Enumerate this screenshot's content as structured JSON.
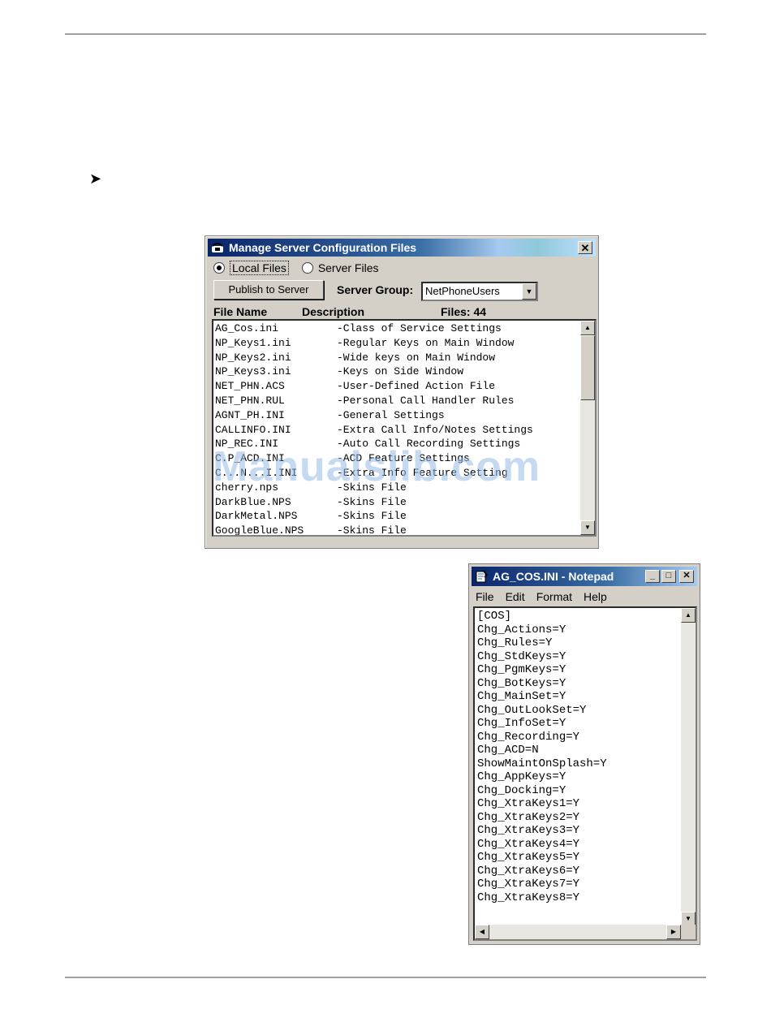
{
  "dialog": {
    "title": "Manage Server Configuration Files",
    "close": "✕",
    "radio_local": "Local Files",
    "radio_server": "Server Files",
    "publish_button": "Publish to Server",
    "server_group_label": "Server Group:",
    "server_group_value": "NetPhoneUsers",
    "col_file_name": "File Name",
    "col_description": "Description",
    "files_count": "Files: 44",
    "files": [
      {
        "name": "AG_Cos.ini",
        "desc": "-Class of Service Settings"
      },
      {
        "name": "NP_Keys1.ini",
        "desc": "-Regular Keys on Main Window"
      },
      {
        "name": "NP_Keys2.ini",
        "desc": "-Wide keys on Main Window"
      },
      {
        "name": "NP_Keys3.ini",
        "desc": "-Keys on Side Window"
      },
      {
        "name": "NET_PHN.ACS",
        "desc": "-User-Defined Action File"
      },
      {
        "name": "NET_PHN.RUL",
        "desc": "-Personal Call Handler Rules"
      },
      {
        "name": "AGNT_PH.INI",
        "desc": "-General Settings"
      },
      {
        "name": "CALLINFO.INI",
        "desc": "-Extra Call Info/Notes Settings"
      },
      {
        "name": "NP_REC.INI",
        "desc": "-Auto Call Recording Settings"
      },
      {
        "name": "C.P_ACD.INI",
        "desc": "-ACD Feature Settings"
      },
      {
        "name": "C...N...I.INI",
        "desc": "-Extra Info Feature Setting"
      },
      {
        "name": "cherry.nps",
        "desc": "-Skins File"
      },
      {
        "name": "DarkBlue.NPS",
        "desc": "-Skins File"
      },
      {
        "name": "DarkMetal.NPS",
        "desc": "-Skins File"
      },
      {
        "name": "GoogleBlue.NPS",
        "desc": "-Skins File"
      }
    ]
  },
  "notepad": {
    "title": "AG_COS.INI - Notepad",
    "menu": [
      "File",
      "Edit",
      "Format",
      "Help"
    ],
    "lines": [
      "[COS]",
      "Chg_Actions=Y",
      "Chg_Rules=Y",
      "Chg_StdKeys=Y",
      "Chg_PgmKeys=Y",
      "Chg_BotKeys=Y",
      "Chg_MainSet=Y",
      "Chg_OutLookSet=Y",
      "Chg_InfoSet=Y",
      "Chg_Recording=Y",
      "Chg_ACD=N",
      "ShowMaintOnSplash=Y",
      "Chg_AppKeys=Y",
      "Chg_Docking=Y",
      "Chg_XtraKeys1=Y",
      "Chg_XtraKeys2=Y",
      "Chg_XtraKeys3=Y",
      "Chg_XtraKeys4=Y",
      "Chg_XtraKeys5=Y",
      "Chg_XtraKeys6=Y",
      "Chg_XtraKeys7=Y",
      "Chg_XtraKeys8=Y"
    ]
  },
  "page": {
    "bullet": "➤",
    "watermark": "Manualslib.com"
  }
}
